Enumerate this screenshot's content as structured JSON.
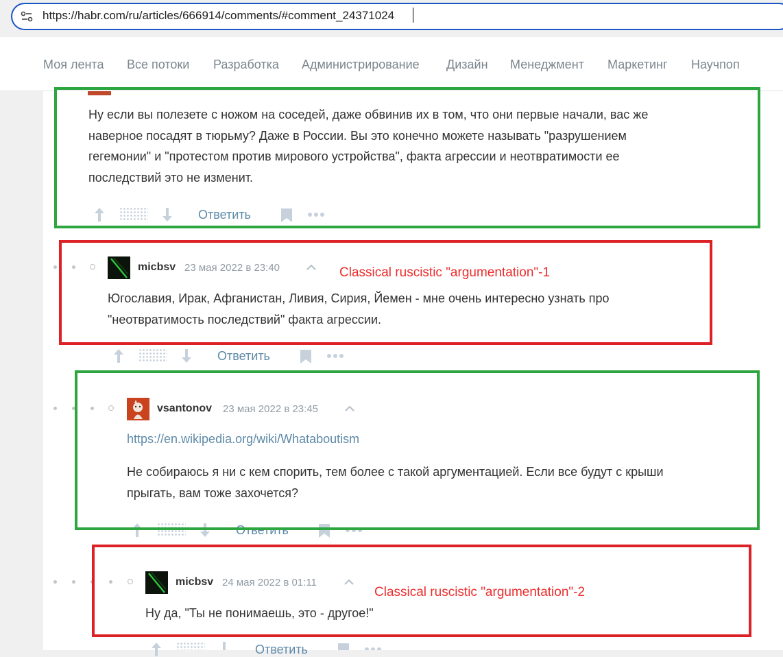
{
  "browser": {
    "url": "https://habr.com/ru/articles/666914/comments/#comment_24371024"
  },
  "nav": {
    "items": [
      "Моя лента",
      "Все потоки",
      "Разработка",
      "Администрирование",
      "Дизайн",
      "Менеджмент",
      "Маркетинг",
      "Научпоп"
    ]
  },
  "comments": [
    {
      "body": [
        "Ну если вы полезете с ножом на соседей, даже обвинив их в том, что они первые начали, вас же",
        "наверное посадят в тюрьму? Даже в России. Вы это конечно можете называть \"разрушением",
        "гегемонии\" и \"протестом против мирового устройства\", факта агрессии и неотвратимости ее",
        "последствий это не изменит."
      ],
      "reply_label": "Ответить"
    },
    {
      "author": "micbsv",
      "date": "23 мая 2022 в 23:40",
      "body": [
        "Югославия, Ирак, Афганистан, Ливия, Сирия, Йемен - мне очень интересно узнать про",
        "\"неотвратимость последствий\" факта агрессии."
      ],
      "reply_label": "Ответить"
    },
    {
      "author": "vsantonov",
      "date": "23 мая 2022 в 23:45",
      "link": "https://en.wikipedia.org/wiki/Whataboutism",
      "body": [
        "Не собираюсь я ни с кем спорить, тем более с такой аргументацией. Если все будут с крыши",
        "прыгать, вам тоже захочется?"
      ],
      "reply_label": "Ответить"
    },
    {
      "author": "micbsv",
      "date": "24 мая 2022 в 01:11",
      "body": [
        "Ну да, \"Ты не понимаешь, это - другое!\""
      ],
      "reply_label": "Ответить"
    }
  ],
  "annotations": [
    "Classical ruscistic \"argumentation\"-1",
    "Classical ruscistic \"argumentation\"-2"
  ],
  "colors": {
    "green_box": "#2da640",
    "red_box": "#dd2227",
    "annotation_text": "#ee2c2c",
    "reply_link": "#5e8aa8"
  }
}
